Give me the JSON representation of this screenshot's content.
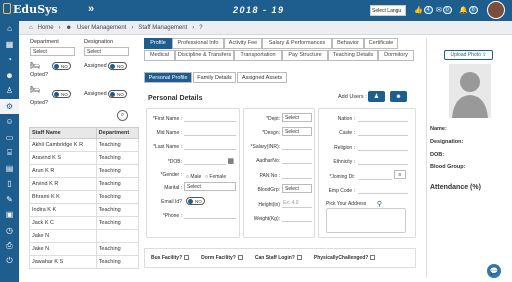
{
  "topbar": {
    "logo": "EduSys",
    "menu_toggle": "»",
    "year": "2018 - 19",
    "lang_select": "Select Langu",
    "thumb_count": "4",
    "mail_count": "0",
    "bell_count": "0"
  },
  "sidebar": {
    "icons": [
      "home-icon",
      "building-icon",
      "dashboard-icon",
      "users-icon",
      "person-icon",
      "user-gear-icon",
      "group-icon",
      "card-icon",
      "bank-icon",
      "book-icon",
      "file-icon",
      "note-icon",
      "bus-icon",
      "clock-icon",
      "printer-icon",
      "logout-icon"
    ]
  },
  "breadcrumb": {
    "home": "Home",
    "module": "User Management",
    "page": "Staff Management",
    "help": "?"
  },
  "filters": {
    "department_label": "Department",
    "department_value": "Select",
    "designation_label": "Designation",
    "designation_value": "Select",
    "opted_label_1": "Opted?",
    "opted_label_2": "Opted?",
    "assigned_1": "Assigned",
    "assigned_2": "Assigned",
    "no_text": "NO"
  },
  "table": {
    "headers": [
      "Staff Name",
      "Department"
    ],
    "rows": [
      [
        "Akhil Cambridge K R",
        "Teaching"
      ],
      [
        "Aravind K S",
        "Teaching"
      ],
      [
        "Arun K R",
        "Teaching"
      ],
      [
        "Arvind K R",
        "Teaching"
      ],
      [
        "Bhrami K K",
        "Teaching"
      ],
      [
        "Indira K K",
        "Teaching"
      ],
      [
        "Jack K C",
        "Teaching"
      ],
      [
        "Jake N",
        ""
      ],
      [
        "Jake N",
        "Teaching"
      ],
      [
        "Jawahar K S",
        "Teaching"
      ]
    ]
  },
  "tabs": {
    "row1": [
      "Profile",
      "Professional Info",
      "Activity Fee",
      "Salary & Performances",
      "Behavior",
      "Certificate"
    ],
    "row2": [
      "Medical",
      "Discipline & Transfers",
      "Transportation",
      "Pay Structure",
      "Teaching Details",
      "Dormitory"
    ]
  },
  "subtabs": [
    "Personal Profile",
    "Family Details",
    "Assigned Assets"
  ],
  "personal": {
    "title": "Personal Details",
    "add_users": "Add Users :"
  },
  "col1": {
    "first_name": "*First Name :",
    "mid_name": "Mid Name :",
    "last_name": "*Last Name :",
    "dob": "*DOB:",
    "gender": "*Gender :",
    "male": "Male",
    "female": "Female",
    "marital": "Marital :",
    "marital_value": "Select",
    "email": "Email Id?",
    "email_toggle": "NO",
    "phone": "*Phone :"
  },
  "col2": {
    "dept": "*Dept:",
    "dept_value": "Select",
    "desgn": "*Desgn:",
    "desgn_value": "Select",
    "salary": "*Salary(INR):",
    "aadhar": "AadharNo:",
    "pan": "PAN No :",
    "blood": "BloodGrp:",
    "blood_value": "Select",
    "height": "Height(in)",
    "height_placeholder": "Ex. 4.9",
    "weight": "Weight(Kg):"
  },
  "col3": {
    "nation": "Nation :",
    "caste": "Caste :",
    "religion": "Religion :",
    "ethnicity": "Ethnicity :",
    "joining": "*Joining Dt:",
    "emp_code": "Emp Code :",
    "address": "Pick Your Address"
  },
  "checks": [
    "Bus Facility?",
    "Dorm Facility?",
    "Can Staff Login?",
    "PhysicallyChallenged?"
  ],
  "right": {
    "upload": "Upload Photo",
    "name": "Name:",
    "designation": "Designation:",
    "dob": "DOB:",
    "blood": "Blood Group:",
    "attendance": "Attendance (%)"
  }
}
